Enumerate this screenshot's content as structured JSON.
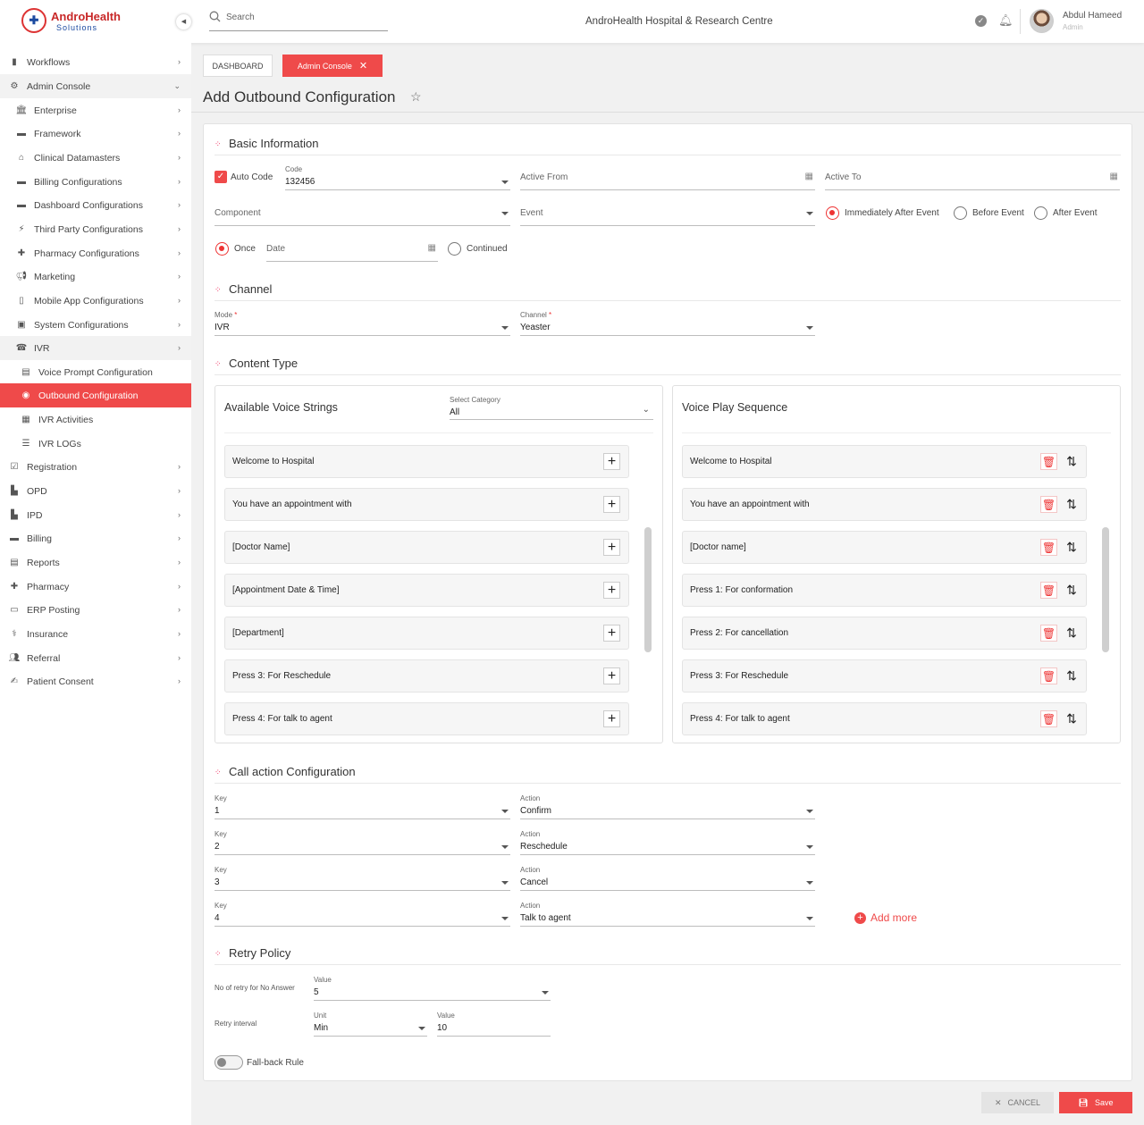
{
  "topbar": {
    "brand": "AndroHealth",
    "brand_sub": "Solutions",
    "search_placeholder": "Search",
    "hospital": "AndroHealth Hospital & Research Centre",
    "user_name": "Abdul Hameed",
    "user_role": "Admin"
  },
  "sidebar": {
    "items": [
      {
        "label": "Workflows"
      },
      {
        "label": "Admin Console"
      },
      {
        "label": "Enterprise"
      },
      {
        "label": "Framework"
      },
      {
        "label": "Clinical Datamasters"
      },
      {
        "label": "Billing Configurations"
      },
      {
        "label": "Dashboard Configurations"
      },
      {
        "label": "Third Party Configurations"
      },
      {
        "label": "Pharmacy Configurations"
      },
      {
        "label": "Marketing"
      },
      {
        "label": "Mobile App Configurations"
      },
      {
        "label": "System Configurations"
      },
      {
        "label": "IVR"
      },
      {
        "label": "Voice Prompt Configuration"
      },
      {
        "label": "Outbound Configuration"
      },
      {
        "label": "IVR Activities"
      },
      {
        "label": "IVR LOGs"
      },
      {
        "label": "Registration"
      },
      {
        "label": "OPD"
      },
      {
        "label": "IPD"
      },
      {
        "label": "Billing"
      },
      {
        "label": "Reports"
      },
      {
        "label": "Pharmacy"
      },
      {
        "label": "ERP Posting"
      },
      {
        "label": "Insurance"
      },
      {
        "label": "Referral"
      },
      {
        "label": "Patient Consent"
      }
    ]
  },
  "tabs": {
    "dashboard": "DASHBOARD",
    "admin": "Admin Console"
  },
  "page": {
    "title": "Add Outbound Configuration"
  },
  "basic": {
    "title": "Basic Information",
    "auto_code": "Auto Code",
    "code_label": "Code",
    "code_value": "132456",
    "active_from": "Active From",
    "active_to": "Active To",
    "component": "Component",
    "event": "Event",
    "immediately": "Immediately After Event",
    "before": "Before Event",
    "after": "After Event",
    "once": "Once",
    "date": "Date",
    "continued": "Continued"
  },
  "channel": {
    "title": "Channel",
    "mode_label": "Mode",
    "mode_value": "IVR",
    "channel_label": "Channel",
    "channel_value": "Yeaster",
    "required": "*"
  },
  "content": {
    "title": "Content Type",
    "available_title": "Available Voice Strings",
    "category_label": "Select Category",
    "category_value": "All",
    "sequence_title": "Voice Play Sequence",
    "available": [
      "Welcome to Hospital",
      "You have an appointment with",
      "[Doctor Name]",
      "[Appointment Date & Time]",
      "[Department]",
      "Press 3:  For Reschedule",
      "Press 4: For talk to agent"
    ],
    "sequence": [
      "Welcome to Hospital",
      "You have an appointment with",
      "[Doctor name]",
      "Press 1:  For conformation",
      "Press 2:  For cancellation",
      "Press 3:  For Reschedule",
      "Press 4: For talk to agent"
    ]
  },
  "call": {
    "title": "Call action Configuration",
    "key_label": "Key",
    "action_label": "Action",
    "rows": [
      {
        "key": "1",
        "action": "Confirm"
      },
      {
        "key": "2",
        "action": "Reschedule"
      },
      {
        "key": "3",
        "action": "Cancel"
      },
      {
        "key": "4",
        "action": "Talk to agent"
      }
    ],
    "add_more": "Add more"
  },
  "retry": {
    "title": "Retry Policy",
    "no_answer": "No of retry for No Answer",
    "value_label": "Value",
    "no_answer_value": "5",
    "interval": "Retry interval",
    "unit_label": "Unit",
    "unit_value": "Min",
    "interval_value": "10",
    "fallback": "Fall-back Rule"
  },
  "footer": {
    "cancel": "CANCEL",
    "save": "Save"
  },
  "colors": {
    "accent": "#ef4a4a",
    "text": "#333333"
  }
}
